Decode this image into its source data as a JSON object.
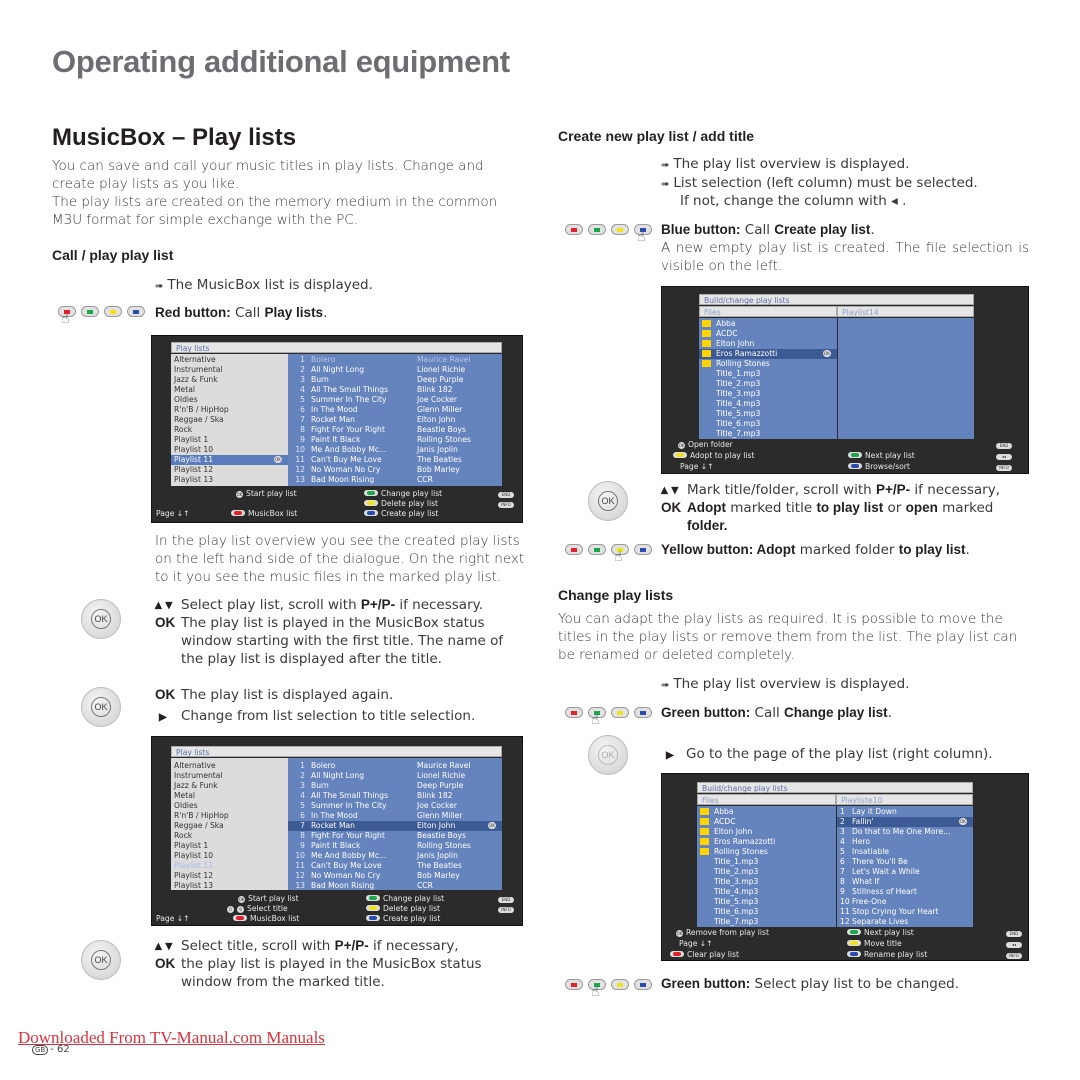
{
  "page": {
    "title": "Operating additional equipment",
    "section_title": "MusicBox – Play lists",
    "intro_1": "You can save and call your music titles in play lists. Change and create play lists as you like.",
    "intro_2": "The play lists are created on the memory medium in the common M3U format for simple exchange with the PC."
  },
  "call_play": {
    "heading": "Call / play play list",
    "note": "The MusicBox list is displayed.",
    "red_label": "Red button:",
    "red_text_1": " Call ",
    "red_text_2": "Play lists",
    "red_text_3": ".",
    "overview_text": "In the play list overview you see the created play lists on the left hand side of the dialogue. On the right next to it you see the music files in the marked play list.",
    "step1_line": "Select play list, scroll with ",
    "step1_bold": "P+/P-",
    "step1_end": " if necessary.",
    "step1_ok": "OK",
    "step1_ok_text": "The play list is played in the MusicBox status window starting with the first title. The name of the play list is displayed after the title.",
    "step2_ok": "OK",
    "step2_ok_text": "The play list is displayed again.",
    "step2_right": "Change from list selection to title selection.",
    "step3_line": "Select title, scroll with ",
    "step3_bold": "P+/P-",
    "step3_end": " if necessary,",
    "step3_ok": "OK",
    "step3_ok_text": "the play list is played in the MusicBox status window from the marked title."
  },
  "screen1": {
    "header": "Play lists",
    "playlists": [
      "Alternative",
      "Instrumental",
      "Jazz &  Funk",
      "Metal",
      "Oldies",
      "R'n'B / HipHop",
      "Reggae / Ska",
      "Rock",
      "Playlist 1",
      "Playlist 10",
      "Playlist 11",
      "Playlist 12",
      "Playlist 13"
    ],
    "selected_playlist": "Playlist 11",
    "tracks": [
      {
        "n": "1",
        "title": "Bolero",
        "artist": "Maurice Ravel"
      },
      {
        "n": "2",
        "title": "All Night Long",
        "artist": "Lionel Richie"
      },
      {
        "n": "3",
        "title": "Burn",
        "artist": "Deep Purple"
      },
      {
        "n": "4",
        "title": "All The Small Things",
        "artist": "Blink 182"
      },
      {
        "n": "5",
        "title": "Summer In The City",
        "artist": "Joe Cocker"
      },
      {
        "n": "6",
        "title": "In The Mood",
        "artist": "Glenn Miller"
      },
      {
        "n": "7",
        "title": "Rocket Man",
        "artist": "Elton John"
      },
      {
        "n": "8",
        "title": "Fight For Your Right",
        "artist": "Beastie Boys"
      },
      {
        "n": "9",
        "title": "Paint It Black",
        "artist": "Rolling Stones"
      },
      {
        "n": "10",
        "title": "Me And Bobby Mc...",
        "artist": "Janis Joplin"
      },
      {
        "n": "11",
        "title": "Can't Buy Me Love",
        "artist": "The Beatles"
      },
      {
        "n": "12",
        "title": "No Woman No Cry",
        "artist": "Bob Marley"
      },
      {
        "n": "13",
        "title": "Bad Moon Rising",
        "artist": "CCR"
      }
    ],
    "footer": {
      "start": "Start play list",
      "change": "Change play list",
      "delete": "Delete play list",
      "create": "Create play list",
      "page": "Page ↓↑",
      "musicbox": "MusicBox list",
      "end": "END",
      "info": "INFO"
    }
  },
  "screen2": {
    "header": "Play lists",
    "selected_track_index": 6,
    "footer": {
      "start": "Start play list",
      "select_title": "Select title",
      "digits": "0-9",
      "change": "Change play list",
      "delete": "Delete play list",
      "create": "Create play list",
      "page": "Page ↓↑",
      "musicbox": "MusicBox list",
      "end": "END",
      "info": "INFO"
    }
  },
  "create": {
    "heading": "Create new play list / add title",
    "note1": "The play list overview is displayed.",
    "note2": "List selection (left column) must be selected.",
    "note2b": "If not, change the column with ◂ .",
    "blue_label": "Blue button:",
    "blue_text_1": " Call ",
    "blue_text_2": "Create play list",
    "blue_text_3": ".",
    "blue_desc": "A new empty play list is created. The file selection is visible on the left.",
    "step_line": "Mark title/folder, scroll with ",
    "step_bold": "P+/P-",
    "step_end": " if necessary,",
    "step_ok": "OK",
    "step_ok_b1": "Adopt",
    "step_ok_t1": " marked title ",
    "step_ok_b2": "to play list",
    "step_ok_t2": " or ",
    "step_ok_b3": "open",
    "step_ok_t3": " marked ",
    "step_ok_b4": "folder.",
    "yellow_label": "Yellow button: Adopt",
    "yellow_text": " marked folder ",
    "yellow_bold": "to play list",
    "yellow_end": "."
  },
  "screen3": {
    "header": "Build/change play lists",
    "col_files": "Files",
    "col_playlist": "Playlist14",
    "folders": [
      "Abba",
      "ACDC",
      "Elton John",
      "Eros Ramazzotti",
      "Rolling Stones"
    ],
    "files": [
      "Title_1.mp3",
      "Title_2.mp3",
      "Title_3.mp3",
      "Title_4.mp3",
      "Title_5.mp3",
      "Title_6.mp3",
      "Title_7.mp3"
    ],
    "selected": "Eros Ramazzotti",
    "footer": {
      "open": "Open folder",
      "adopt": "Adopt to play list",
      "next": "Next play list",
      "page": "Page ↓↑",
      "browse": "Browse/sort",
      "end": "END",
      "rew": "◂◂",
      "info": "INFO"
    }
  },
  "change": {
    "heading": "Change play lists",
    "desc": "You can adapt the play lists as required. It is possible to move the titles in the play lists or remove them from the list. The play list can be renamed or deleted completely.",
    "note": "The play list overview is displayed.",
    "green_label": "Green button:",
    "green_text_1": " Call ",
    "green_text_2": "Change play list",
    "green_text_3": ".",
    "goto": "Go to the page of the play list (right column).",
    "green2_label": "Green button:",
    "green2_text": " Select play list to be changed."
  },
  "screen4": {
    "header": "Build/change play lists",
    "col_files": "Files",
    "col_playlist": "Playliste10",
    "tracks": [
      "Lay it Down",
      "Fallin'",
      "Do that to Me One More...",
      "Hero",
      "Insatiable",
      "There You'll Be",
      "Let's Wait a While",
      "What If",
      "Stillness of Heart",
      "Free-One",
      "Stop Crying Your Heart",
      "Separate Lives"
    ],
    "selected_track": "Fallin'",
    "footer": {
      "remove": "Remove from play list",
      "next": "Next play list",
      "page": "Page ↓↑",
      "move": "Move title",
      "clear": "Clear play list",
      "rename": "Rename play list",
      "end": "END",
      "rew": "◂◂",
      "info": "INFO"
    }
  },
  "footer": {
    "link": "Downloaded From TV-Manual.com Manuals",
    "region": "GB",
    "page": "- 62"
  },
  "colors": {
    "red": "#e3202a",
    "green": "#1aa84a",
    "yellow": "#f2e21a",
    "blue": "#2a4bb0",
    "panel_blue": "#6583bd",
    "select_blue": "#3c5a93"
  }
}
